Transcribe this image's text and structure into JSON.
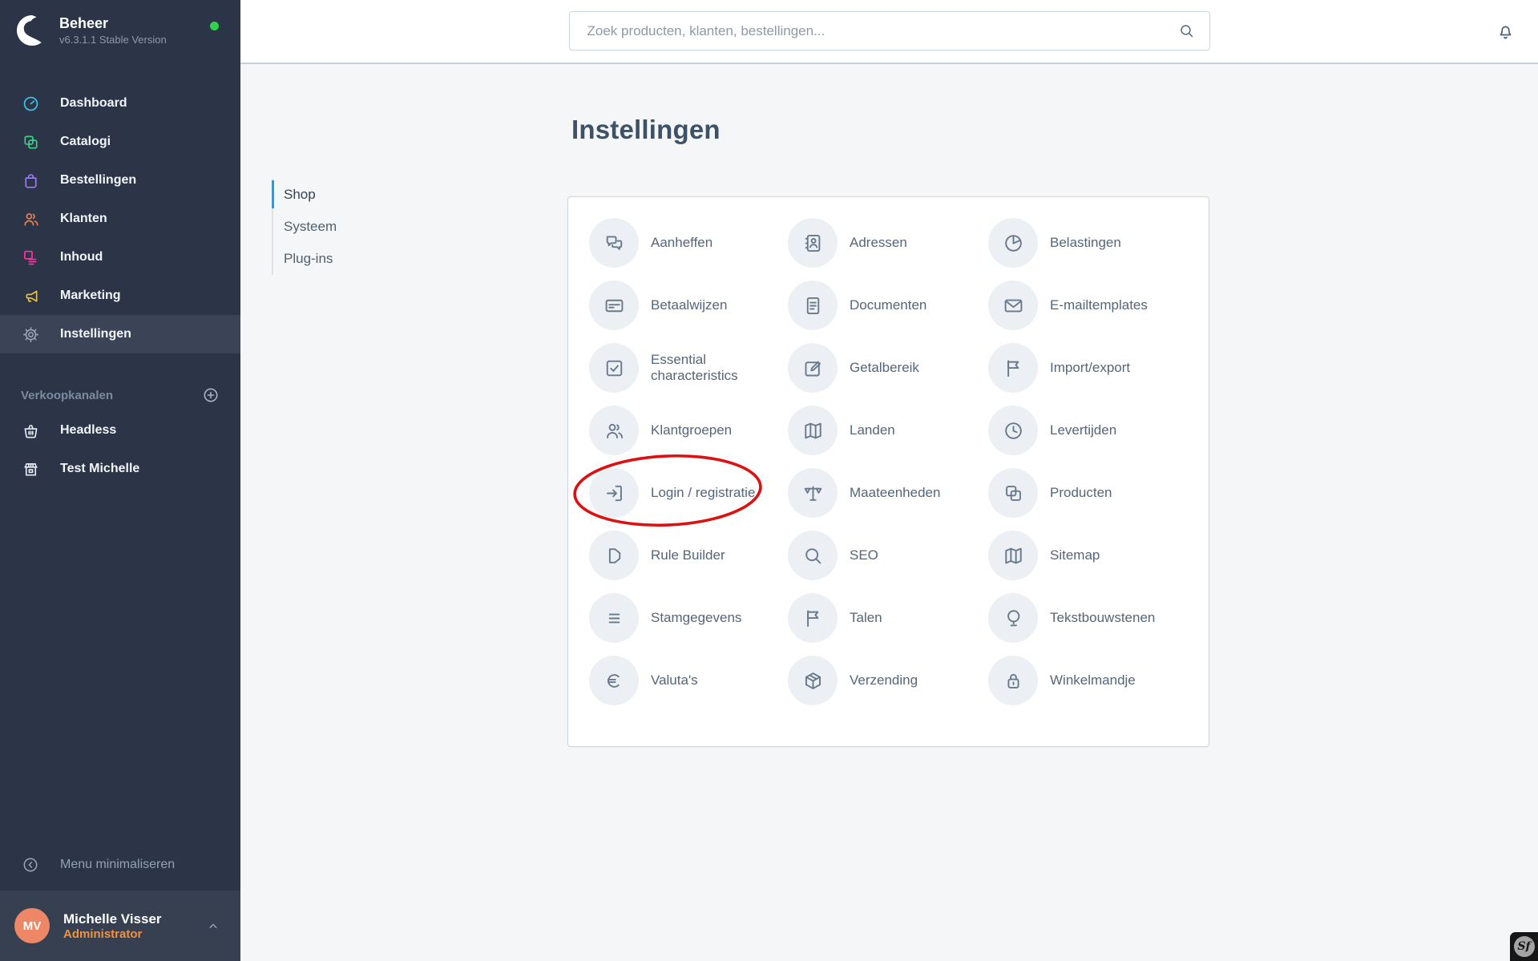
{
  "app": {
    "name": "Beheer",
    "version": "v6.3.1.1 Stable Version"
  },
  "theme": {
    "accent": "#189eff",
    "sidebar_bg": "#2c3547",
    "card_border": "#cdd5dd"
  },
  "status": {
    "online_dot_color": "#33d04a"
  },
  "topbar": {
    "search_placeholder": "Zoek producten, klanten, bestellingen...",
    "search_value": ""
  },
  "sidebar": {
    "items": [
      {
        "label": "Dashboard",
        "icon": "dashboard-gauge",
        "color": "#40c6ea",
        "active": false
      },
      {
        "label": "Catalogi",
        "icon": "catalog-squares",
        "color": "#3bd689",
        "active": false
      },
      {
        "label": "Bestellingen",
        "icon": "shopping-bag",
        "color": "#9d7ff2",
        "active": false
      },
      {
        "label": "Klanten",
        "icon": "users",
        "color": "#f08255",
        "active": false
      },
      {
        "label": "Inhoud",
        "icon": "content-layout",
        "color": "#f43ba4",
        "active": false
      },
      {
        "label": "Marketing",
        "icon": "megaphone",
        "color": "#f5c525",
        "active": false
      },
      {
        "label": "Instellingen",
        "icon": "gear",
        "color": "#97a1b3",
        "active": true
      }
    ],
    "sales_channels": {
      "heading": "Verkoopkanalen",
      "items": [
        {
          "label": "Headless",
          "icon": "basket"
        },
        {
          "label": "Test Michelle",
          "icon": "storefront"
        }
      ]
    },
    "minimize_label": "Menu minimaliseren",
    "user": {
      "initials": "MV",
      "name": "Michelle Visser",
      "role": "Administrator",
      "avatar_color": "#ee8765",
      "role_color": "#ef9340"
    }
  },
  "main": {
    "title": "Instellingen",
    "tabs": [
      {
        "label": "Shop",
        "active": true
      },
      {
        "label": "Systeem",
        "active": false
      },
      {
        "label": "Plug-ins",
        "active": false
      }
    ],
    "settings_items": [
      {
        "label": "Aanheffen",
        "icon": "chat-bubbles"
      },
      {
        "label": "Adressen",
        "icon": "address-book"
      },
      {
        "label": "Belastingen",
        "icon": "pie-chart"
      },
      {
        "label": "Betaalwijzen",
        "icon": "credit-card"
      },
      {
        "label": "Documenten",
        "icon": "document"
      },
      {
        "label": "E-mailtemplates",
        "icon": "envelope"
      },
      {
        "label": "Essential characteristics",
        "icon": "checkbox"
      },
      {
        "label": "Getalbereik",
        "icon": "edit-square"
      },
      {
        "label": "Import/export",
        "icon": "flag"
      },
      {
        "label": "Klantgroepen",
        "icon": "users"
      },
      {
        "label": "Landen",
        "icon": "map"
      },
      {
        "label": "Levertijden",
        "icon": "clock"
      },
      {
        "label": "Login / registratie",
        "icon": "login-arrow",
        "annotated": true
      },
      {
        "label": "Maateenheden",
        "icon": "balance-scale"
      },
      {
        "label": "Producten",
        "icon": "catalog-squares"
      },
      {
        "label": "Rule Builder",
        "icon": "rule-shape"
      },
      {
        "label": "SEO",
        "icon": "magnifier"
      },
      {
        "label": "Sitemap",
        "icon": "map"
      },
      {
        "label": "Stamgegevens",
        "icon": "menu-lines"
      },
      {
        "label": "Talen",
        "icon": "flag"
      },
      {
        "label": "Tekstbouwstenen",
        "icon": "text-module"
      },
      {
        "label": "Valuta's",
        "icon": "euro"
      },
      {
        "label": "Verzending",
        "icon": "package"
      },
      {
        "label": "Winkelmandje",
        "icon": "padlock"
      }
    ]
  },
  "annotation": {
    "color": "#dd1111"
  },
  "symfony_badge": {
    "label": "Sf"
  }
}
